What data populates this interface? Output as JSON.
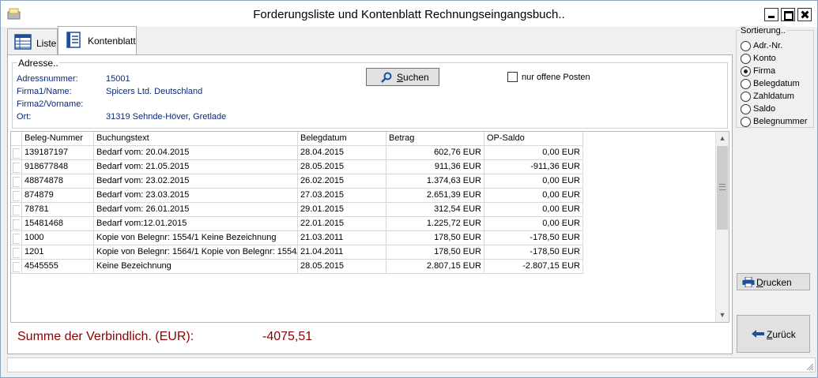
{
  "window": {
    "title": "Forderungsliste und Kontenblatt Rechnungseingangsbuch..",
    "controls": [
      "minimize-icon",
      "maximize-icon",
      "close-icon"
    ]
  },
  "tabs": [
    {
      "label": "Liste",
      "icon": "table-icon",
      "active": false
    },
    {
      "label": "Kontenblatt",
      "icon": "ledger-icon",
      "active": true
    }
  ],
  "address": {
    "legend": "Adresse..",
    "fields": [
      {
        "label": "Adressnummer:",
        "value": "15001"
      },
      {
        "label": "Firma1/Name:",
        "value": "Spicers Ltd. Deutschland"
      },
      {
        "label": "Firma2/Vorname:",
        "value": ""
      },
      {
        "label": "Ort:",
        "value": "31319 Sehnde-Höver, Gretlade"
      }
    ]
  },
  "search": {
    "button_label": "Suchen",
    "icon": "magnifier-icon"
  },
  "filter": {
    "checkbox_label": "nur offene Posten",
    "checked": false
  },
  "grid": {
    "columns": [
      "Beleg-Nummer",
      "Buchungstext",
      "Belegdatum",
      "Betrag",
      "OP-Saldo"
    ],
    "rows": [
      [
        "139187197",
        "Bedarf vom: 20.04.2015",
        "28.04.2015",
        "602,76 EUR",
        "0,00 EUR"
      ],
      [
        "918677848",
        "Bedarf vom: 21.05.2015",
        "28.05.2015",
        "911,36 EUR",
        "-911,36 EUR"
      ],
      [
        "48874878",
        "Bedarf vom: 23.02.2015",
        "26.02.2015",
        "1.374,63 EUR",
        "0,00 EUR"
      ],
      [
        "874879",
        "Bedarf vom: 23.03.2015",
        "27.03.2015",
        "2.651,39 EUR",
        "0,00 EUR"
      ],
      [
        "78781",
        "Bedarf vom: 26.01.2015",
        "29.01.2015",
        "312,54 EUR",
        "0,00 EUR"
      ],
      [
        "15481468",
        "Bedarf vom:12.01.2015",
        "22.01.2015",
        "1.225,72 EUR",
        "0,00 EUR"
      ],
      [
        "1000",
        "Kopie von Belegnr: 1554/1 Keine Bezeichnung",
        "21.03.2011",
        "178,50 EUR",
        "-178,50 EUR"
      ],
      [
        "1201",
        "Kopie von Belegnr: 1564/1 Kopie von Belegnr: 1554/",
        "21.04.2011",
        "178,50 EUR",
        "-178,50 EUR"
      ],
      [
        "4545555",
        "Keine Bezeichnung",
        "28.05.2015",
        "2.807,15 EUR",
        "-2.807,15 EUR"
      ]
    ]
  },
  "summary": {
    "label": "Summe der Verbindlich. (EUR):",
    "value": "-4075,51",
    "color": "#8b0000"
  },
  "sorting": {
    "legend": "Sortierung..",
    "options": [
      {
        "label": "Adr.-Nr.",
        "selected": false
      },
      {
        "label": "Konto",
        "selected": false
      },
      {
        "label": "Firma",
        "selected": true
      },
      {
        "label": "Belegdatum",
        "selected": false
      },
      {
        "label": "Zahldatum",
        "selected": false
      },
      {
        "label": "Saldo",
        "selected": false
      },
      {
        "label": "Belegnummer",
        "selected": false
      }
    ]
  },
  "actions": {
    "print_label": "Drucken",
    "print_icon": "printer-icon",
    "back_label": "Zurück",
    "back_icon": "arrow-left-icon"
  }
}
